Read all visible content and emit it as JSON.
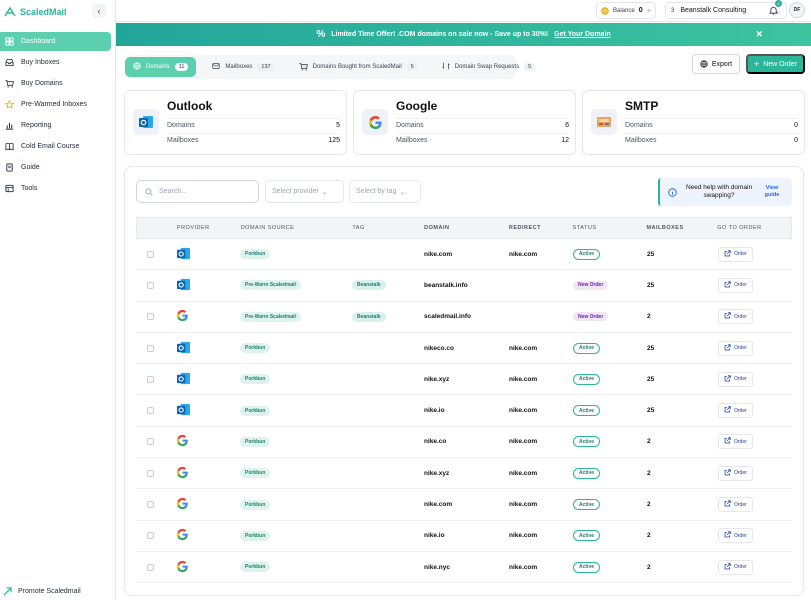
{
  "app": {
    "name": "ScaledMail"
  },
  "sidebar": {
    "items": [
      {
        "label": "Dashboard",
        "icon": "grid-icon",
        "active": true
      },
      {
        "label": "Buy Inboxes",
        "icon": "inbox-icon"
      },
      {
        "label": "Buy Domains",
        "icon": "cart-icon"
      },
      {
        "label": "Pre-Warmed Inboxes",
        "icon": "star-icon"
      },
      {
        "label": "Reporting",
        "icon": "chart-icon"
      },
      {
        "label": "Cold Email Course",
        "icon": "book-icon"
      },
      {
        "label": "Guide",
        "icon": "guide-icon"
      },
      {
        "label": "Tools",
        "icon": "tools-icon"
      }
    ],
    "promote": "Promote Scaledmail"
  },
  "topbar": {
    "balance_label": "Balance",
    "balance_value": "0",
    "workspace_count": "3",
    "workspace_name": "Beanstalk Consulting",
    "notification_count": "1",
    "avatar_initials": "DF"
  },
  "banner": {
    "text": "Limited Time Offer! .COM domains on sale now - Save up to 30%!",
    "link": "Get Your Domain"
  },
  "tabs": [
    {
      "label": "Domains",
      "count": "11",
      "active": true
    },
    {
      "label": "Mailboxes",
      "count": "137"
    },
    {
      "label": "Domains Bought from ScaledMail",
      "count": "5"
    },
    {
      "label": "Domain Swap Requests",
      "count": "5"
    }
  ],
  "actions": {
    "export": "Export",
    "new_order": "New Order"
  },
  "cards": [
    {
      "title": "Outlook",
      "domains_label": "Domains",
      "domains": "5",
      "mailboxes_label": "Mailboxes",
      "mailboxes": "125"
    },
    {
      "title": "Google",
      "domains_label": "Domains",
      "domains": "6",
      "mailboxes_label": "Mailboxes",
      "mailboxes": "12"
    },
    {
      "title": "SMTP",
      "domains_label": "Domains",
      "domains": "0",
      "mailboxes_label": "Mailboxes",
      "mailboxes": "0"
    }
  ],
  "filters": {
    "search_placeholder": "Search...",
    "provider_placeholder": "Select provider",
    "tag_placeholder": "Select by tag"
  },
  "help": {
    "text": "Need help with domain swapping?",
    "link": "View guide"
  },
  "table": {
    "headers": [
      "PROVIDER",
      "DOMAIN SOURCE",
      "TAG",
      "DOMAIN",
      "REDIRECT",
      "STATUS",
      "MAILBOXES",
      "GO TO ORDER"
    ],
    "order_label": "Order",
    "rows": [
      {
        "provider": "outlook",
        "source": "Porkbun",
        "tag": "",
        "domain": "nike.com",
        "redirect": "nike.com",
        "status": "Active",
        "mailboxes": "25"
      },
      {
        "provider": "outlook",
        "source": "Pre-Warm Scaledmail",
        "tag": "Beanstalk",
        "domain": "beanstalk.info",
        "redirect": "",
        "status": "New Order",
        "mailboxes": "25"
      },
      {
        "provider": "google",
        "source": "Pre-Warm Scaledmail",
        "tag": "Beanstalk",
        "domain": "scaledmail.info",
        "redirect": "",
        "status": "New Order",
        "mailboxes": "2"
      },
      {
        "provider": "outlook",
        "source": "Porkbun",
        "tag": "",
        "domain": "nikeco.co",
        "redirect": "nike.com",
        "status": "Active",
        "mailboxes": "25"
      },
      {
        "provider": "outlook",
        "source": "Porkbun",
        "tag": "",
        "domain": "nike.xyz",
        "redirect": "nike.com",
        "status": "Active",
        "mailboxes": "25"
      },
      {
        "provider": "outlook",
        "source": "Porkbun",
        "tag": "",
        "domain": "nike.io",
        "redirect": "nike.com",
        "status": "Active",
        "mailboxes": "25"
      },
      {
        "provider": "google",
        "source": "Porkbun",
        "tag": "",
        "domain": "nike.co",
        "redirect": "nike.com",
        "status": "Active",
        "mailboxes": "2"
      },
      {
        "provider": "google",
        "source": "Porkbun",
        "tag": "",
        "domain": "nike.xyz",
        "redirect": "nike.com",
        "status": "Active",
        "mailboxes": "2"
      },
      {
        "provider": "google",
        "source": "Porkbun",
        "tag": "",
        "domain": "nike.com",
        "redirect": "nike.com",
        "status": "Active",
        "mailboxes": "2"
      },
      {
        "provider": "google",
        "source": "Porkbun",
        "tag": "",
        "domain": "nike.io",
        "redirect": "nike.com",
        "status": "Active",
        "mailboxes": "2"
      },
      {
        "provider": "google",
        "source": "Porkbun",
        "tag": "",
        "domain": "nike.nyc",
        "redirect": "nike.com",
        "status": "Active",
        "mailboxes": "2"
      }
    ]
  },
  "colors": {
    "accent": "#2bb59a",
    "active_tab": "#5ccfae",
    "banner": "#22a69a"
  }
}
